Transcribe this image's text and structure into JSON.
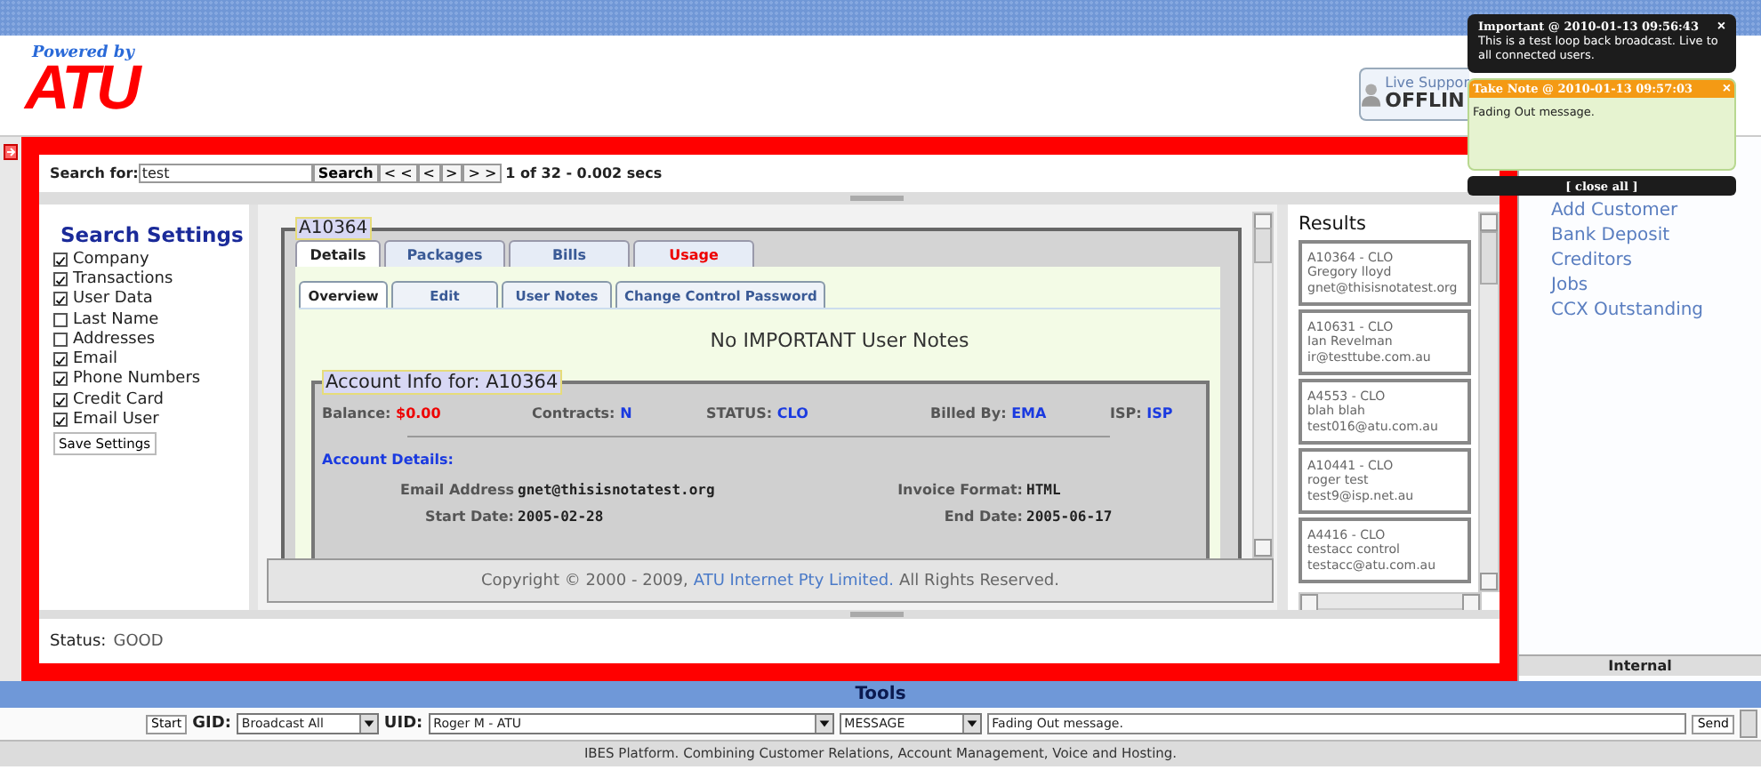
{
  "header": {
    "tagline": "Powered by",
    "logo": "ATU",
    "live_support": {
      "label": "Live Suppor",
      "status": "OFFLIN"
    }
  },
  "search": {
    "label": "Search for:",
    "value": "test",
    "button": "Search",
    "nav": [
      "< <",
      "<",
      ">",
      "> >"
    ],
    "summary": "1 of 32 - 0.002 secs"
  },
  "search_settings": {
    "title": "Search Settings",
    "options": [
      {
        "label": "Company",
        "checked": true
      },
      {
        "label": "Transactions",
        "checked": true
      },
      {
        "label": "User Data",
        "checked": true
      },
      {
        "label": "Last Name",
        "checked": false
      },
      {
        "label": "Addresses",
        "checked": false
      },
      {
        "label": "Email",
        "checked": true
      },
      {
        "label": "Phone Numbers",
        "checked": true
      },
      {
        "label": "Credit Card",
        "checked": true
      },
      {
        "label": "Email User",
        "checked": true
      }
    ],
    "save_button": "Save Settings"
  },
  "account": {
    "legend": "A10364",
    "tabs": [
      {
        "label": "Details",
        "selected": true,
        "kind": "normal"
      },
      {
        "label": "Packages",
        "selected": false,
        "kind": "normal"
      },
      {
        "label": "Bills",
        "selected": false,
        "kind": "normal"
      },
      {
        "label": "Usage",
        "selected": false,
        "kind": "alert"
      }
    ],
    "subtabs": [
      {
        "label": "Overview",
        "selected": true
      },
      {
        "label": "Edit",
        "selected": false
      },
      {
        "label": "User Notes",
        "selected": false
      },
      {
        "label": "Change Control Password",
        "selected": false
      }
    ],
    "notice": "No IMPORTANT User Notes",
    "info": {
      "legend": "Account Info for: A10364",
      "fields": [
        {
          "label": "Balance:",
          "value": "$0.00",
          "kind": "alert"
        },
        {
          "label": "Contracts:",
          "value": "N",
          "kind": "link"
        },
        {
          "label": "STATUS:",
          "value": "CLO",
          "kind": "link"
        },
        {
          "label": "Billed By:",
          "value": "EMA",
          "kind": "link"
        },
        {
          "label": "ISP:",
          "value": "ISP",
          "kind": "link"
        }
      ],
      "details_heading": "Account Details:",
      "details": [
        {
          "label": "Email Address",
          "value": "gnet@thisisnotatest.org"
        },
        {
          "label": "Invoice Format:",
          "value": "HTML"
        },
        {
          "label": "Start Date:",
          "value": "2005-02-28"
        },
        {
          "label": "End Date:",
          "value": "2005-06-17"
        }
      ]
    }
  },
  "copyright": {
    "text": "Copyright © 2000 - 2009,",
    "link": "ATU Internet Pty Limited.",
    "suffix": "All Rights Reserved."
  },
  "results": {
    "title": "Results",
    "items": [
      {
        "id": "A10364 - CLO",
        "name": "Gregory lloyd",
        "email": "gnet@thisisnotatest.org"
      },
      {
        "id": "A10631 - CLO",
        "name": "Ian Revelman",
        "email": "ir@testtube.com.au"
      },
      {
        "id": "A4553 - CLO",
        "name": "blah blah",
        "email": "test016@atu.com.au"
      },
      {
        "id": "A10441 - CLO",
        "name": "roger test",
        "email": "test9@isp.net.au"
      },
      {
        "id": "A4416 - CLO",
        "name": "testacc control",
        "email": "testacc@atu.com.au"
      }
    ]
  },
  "status": {
    "label": "Status:",
    "value": "GOOD"
  },
  "side_links": [
    "Add Customer",
    "Bank Deposit",
    "Creditors",
    "Jobs",
    "CCX Outstanding"
  ],
  "side_footer": "Internal",
  "tools": {
    "title": "Tools",
    "start": "Start",
    "gid_label": "GID:",
    "gid": "Broadcast All",
    "uid_label": "UID:",
    "uid": "Roger M - ATU",
    "type": "MESSAGE",
    "message": "Fading Out message.",
    "send": "Send"
  },
  "footer": "IBES Platform. Combining Customer Relations, Account Management, Voice and Hosting.",
  "notifications": [
    {
      "kind": "important",
      "title": "Important @ 2010-01-13 09:56:43",
      "body": "This is a test loop back broadcast. Live to all connected users.",
      "close": "×"
    },
    {
      "kind": "note",
      "title": "Take Note @ 2010-01-13 09:57:03",
      "body": "Fading Out message.",
      "close": "×"
    }
  ],
  "close_all": "[ close all ]"
}
